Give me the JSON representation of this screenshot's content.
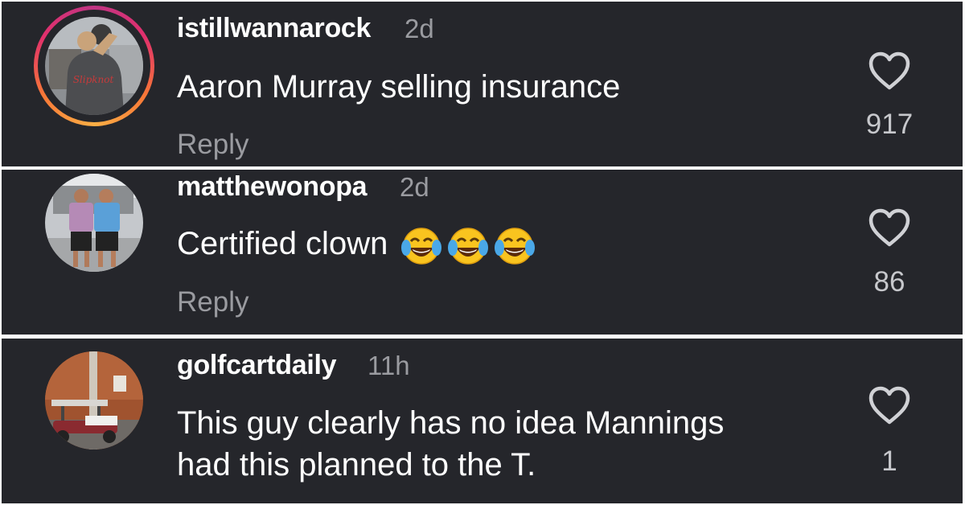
{
  "comments": [
    {
      "username": "istillwannarock",
      "time": "2d",
      "text": "Aaron Murray selling insurance",
      "reply_label": "Reply",
      "likes": "917",
      "has_story_ring": true,
      "avatar_shirt_text": "Slipknot"
    },
    {
      "username": "matthewonopa",
      "time": "2d",
      "text": "Certified clown",
      "emojis": [
        "face-with-tears-of-joy",
        "face-with-tears-of-joy",
        "face-with-tears-of-joy"
      ],
      "reply_label": "Reply",
      "likes": "86",
      "has_story_ring": false
    },
    {
      "username": "golfcartdaily",
      "time": "11h",
      "text_lines": [
        "This guy clearly has no idea Mannings",
        "had this planned to the T."
      ],
      "likes": "1",
      "has_story_ring": false
    }
  ],
  "colors": {
    "background": "#25262b",
    "text": "#ffffff",
    "muted": "#9a9ba0",
    "heart_outline": "#d0d1d5",
    "story_ring": [
      "#c13584",
      "#f77737",
      "#fcaf45"
    ]
  }
}
